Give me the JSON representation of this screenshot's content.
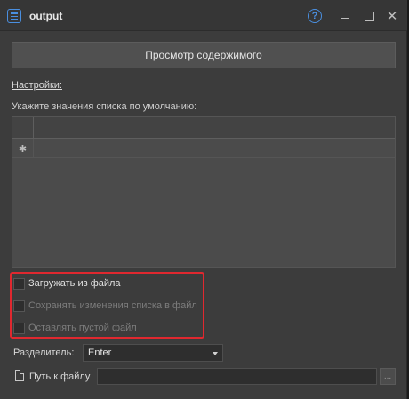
{
  "window": {
    "title": "output",
    "help_glyph": "?",
    "close_glyph": "✕",
    "accent_color": "#4a8fe0"
  },
  "main": {
    "preview_button_label": "Просмотр содержимого",
    "settings_link": "Настройки:",
    "default_values_label": "Укажите значения списка по умолчанию:",
    "list": {
      "new_row_marker": "✱",
      "rows": []
    }
  },
  "options": {
    "highlight_color": "#e0282f",
    "checkboxes": [
      {
        "label": "Загружать из файла",
        "checked": false,
        "enabled": true
      },
      {
        "label": "Сохранять изменения списка в файл",
        "checked": false,
        "enabled": false
      },
      {
        "label": "Оставлять пустой файл",
        "checked": false,
        "enabled": false
      }
    ]
  },
  "separator": {
    "label": "Разделитель:",
    "value": "Enter"
  },
  "file_path": {
    "label": "Путь к файлу",
    "value": "",
    "browse_label": "..."
  }
}
